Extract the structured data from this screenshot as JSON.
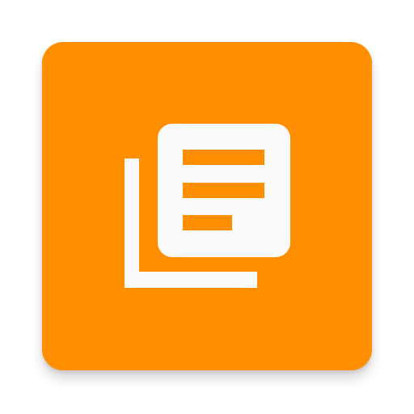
{
  "app": {
    "icon": "library-books-icon",
    "background_color": "#ff8f00",
    "foreground_color": "#fafafa"
  }
}
